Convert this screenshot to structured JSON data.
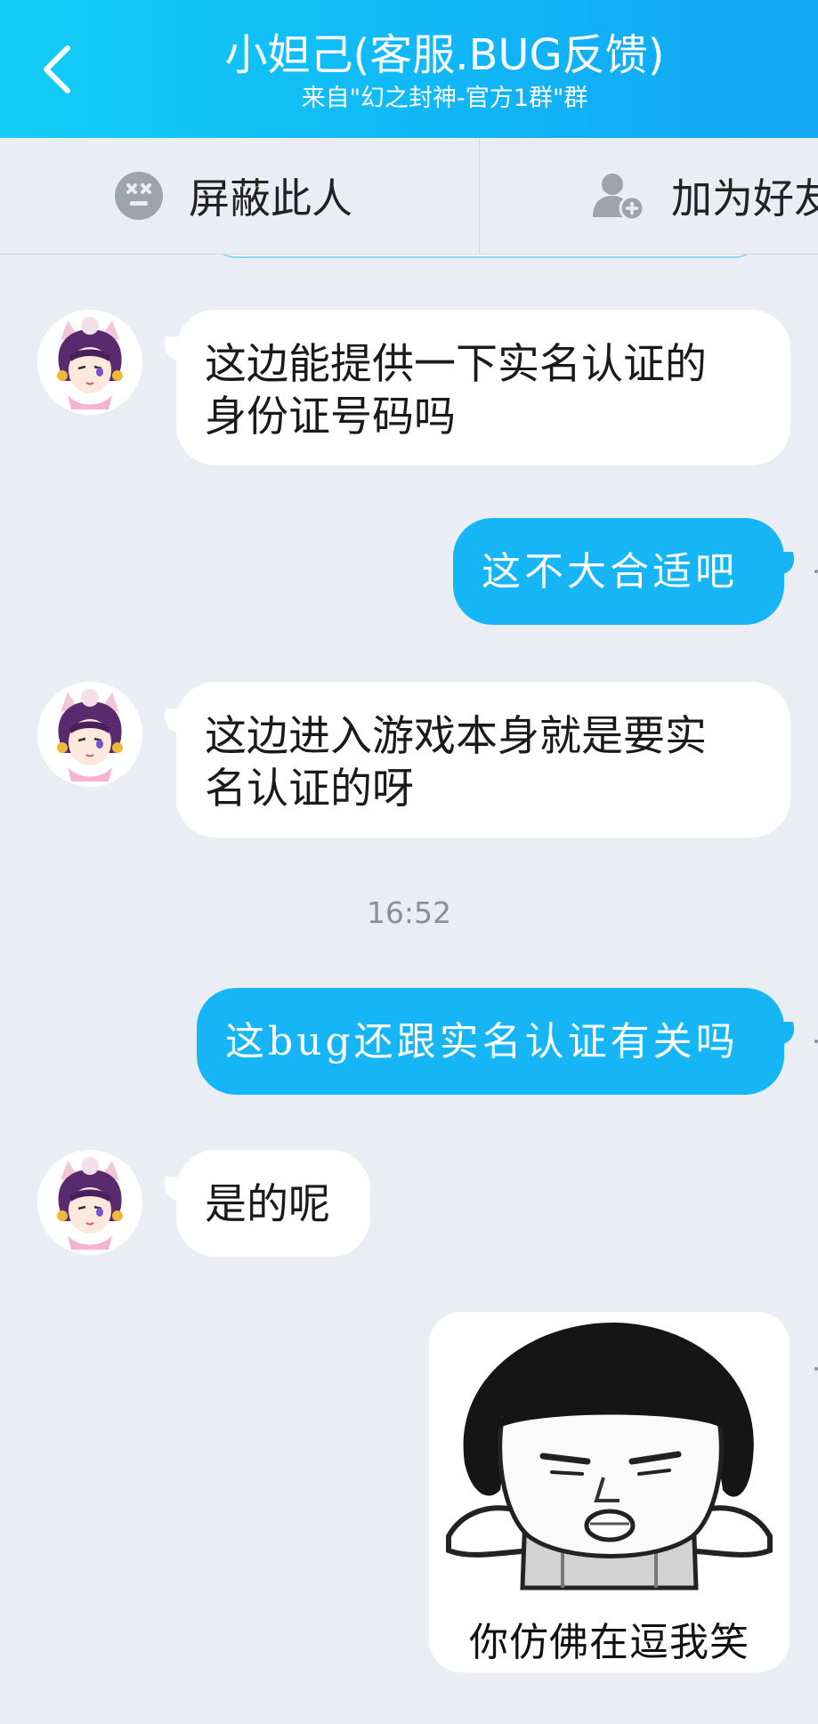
{
  "header": {
    "title": "小妲己(客服.BUG反馈)",
    "subtitle": "来自\"幻之封神-官方1群\"群",
    "back_icon": "chevron-left-icon",
    "background": "#13b9f6"
  },
  "actions": {
    "block": {
      "label": "屏蔽此人",
      "icon": "block-face-icon"
    },
    "add_friend": {
      "label": "加为好友",
      "icon": "add-user-icon"
    }
  },
  "messages": [
    {
      "side": "left",
      "sender_avatar": "dajie-avatar",
      "text_line1": "这边能提供一下实名认证的",
      "text_line2": "身份证号码吗"
    },
    {
      "side": "right",
      "text": "这不大合适吧"
    },
    {
      "side": "left",
      "sender_avatar": "dajie-avatar",
      "text_line1": "这边进入游戏本身就是要实",
      "text_line2": "名认证的呀"
    },
    {
      "type": "timestamp",
      "text": "16:52"
    },
    {
      "side": "right",
      "text": "这bug还跟实名认证有关吗"
    },
    {
      "side": "left",
      "sender_avatar": "dajie-avatar",
      "text": "是的呢"
    },
    {
      "side": "right",
      "type": "sticker",
      "caption": "你仿佛在逗我笑"
    }
  ],
  "colors": {
    "chat_background": "#eaedf4",
    "outgoing_bubble": "#16b6f6",
    "incoming_bubble": "#ffffff"
  }
}
